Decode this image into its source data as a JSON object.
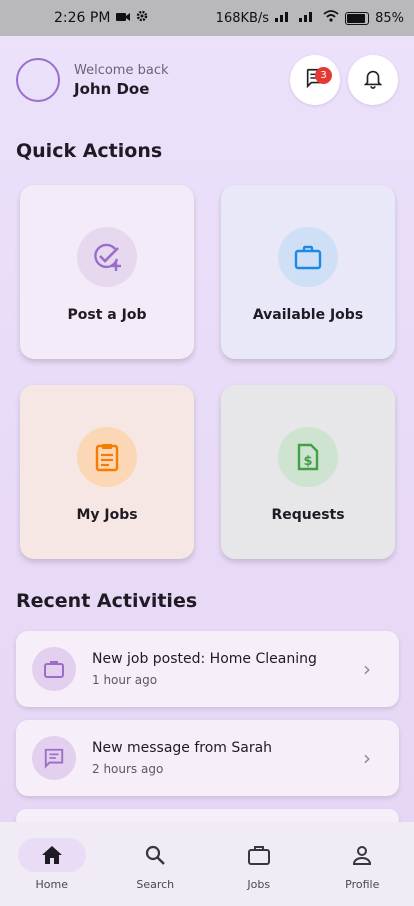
{
  "status_bar": {
    "time": "2:26 PM",
    "speed": "168KB/s",
    "battery": "85%"
  },
  "header": {
    "welcome": "Welcome back",
    "name": "John Doe",
    "message_badge": "3"
  },
  "quick_actions": {
    "title": "Quick Actions",
    "items": [
      {
        "label": "Post a Job",
        "icon": "add-task-icon",
        "color": "#9c6cc9"
      },
      {
        "label": "Available Jobs",
        "icon": "briefcase-icon",
        "color": "#1e88e5"
      },
      {
        "label": "My Jobs",
        "icon": "clipboard-icon",
        "color": "#f57c00"
      },
      {
        "label": "Requests",
        "icon": "receipt-dollar-icon",
        "color": "#43a047"
      }
    ]
  },
  "recent": {
    "title": "Recent Activities",
    "items": [
      {
        "title": "New job posted: Home Cleaning",
        "time": "1 hour ago",
        "icon": "briefcase-icon"
      },
      {
        "title": "New message from Sarah",
        "time": "2 hours ago",
        "icon": "message-icon"
      }
    ]
  },
  "nav": [
    {
      "label": "Home",
      "icon": "home-icon",
      "active": true
    },
    {
      "label": "Search",
      "icon": "search-icon"
    },
    {
      "label": "Jobs",
      "icon": "briefcase-icon"
    },
    {
      "label": "Profile",
      "icon": "person-icon"
    }
  ]
}
